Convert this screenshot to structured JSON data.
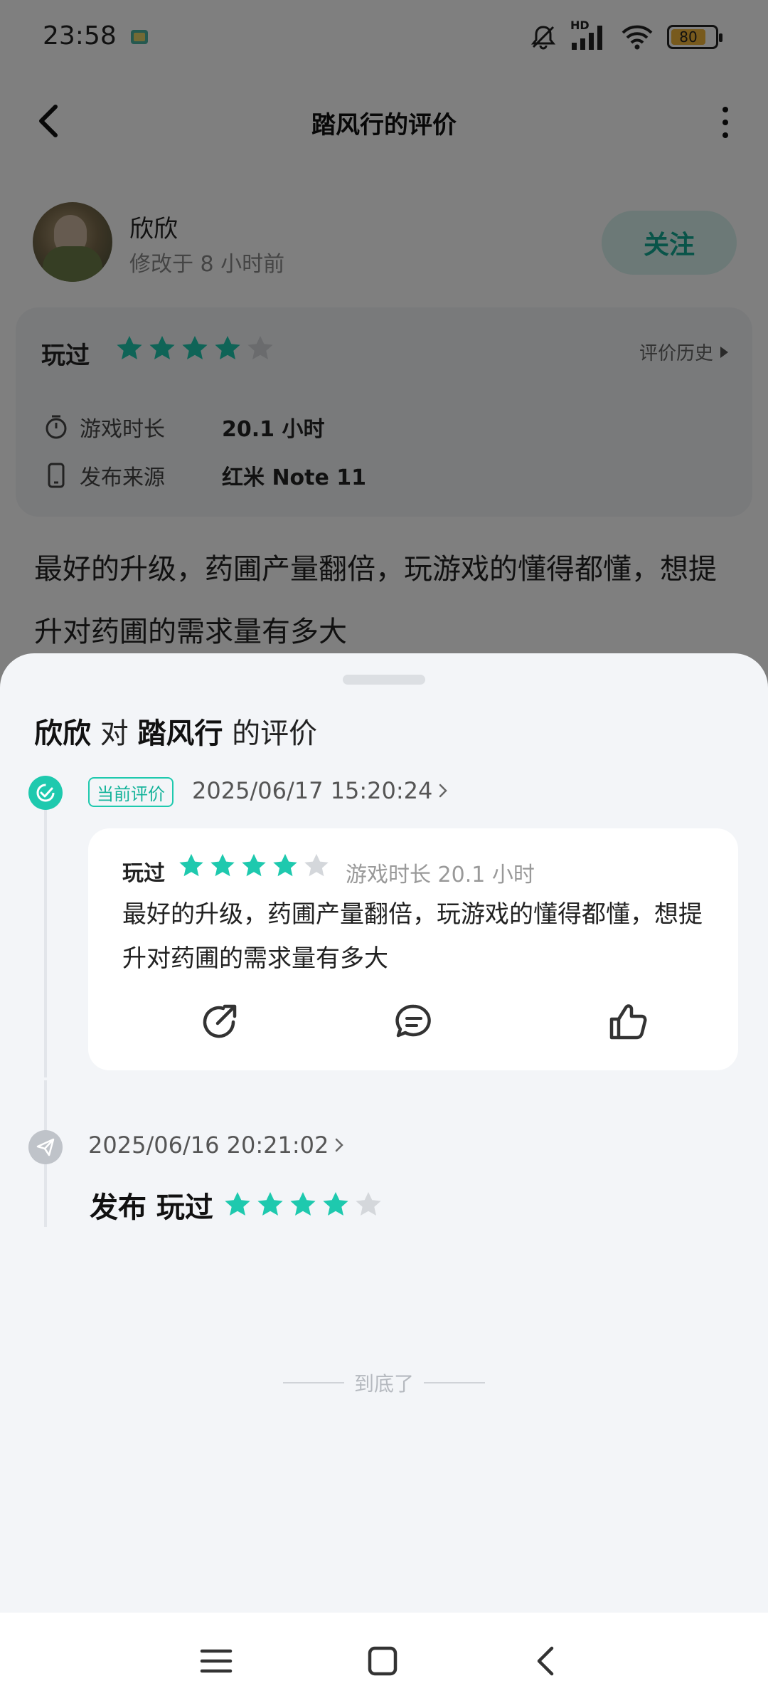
{
  "status_bar": {
    "time": "23:58",
    "network_label": "HD",
    "battery": "80",
    "icons": [
      "bell-muted-icon",
      "signal-icon",
      "wifi-icon",
      "battery-icon"
    ]
  },
  "header": {
    "title": "踏风行的评价"
  },
  "author": {
    "name": "欣欣",
    "meta": "修改于 8 小时前",
    "follow_label": "关注"
  },
  "info_card": {
    "played_label": "玩过",
    "rating": 4,
    "rating_max": 5,
    "history_label": "评价历史",
    "rows": [
      {
        "label": "游戏时长",
        "value": "20.1 小时",
        "icon": "timer-icon"
      },
      {
        "label": "发布来源",
        "value": "红米 Note 11",
        "icon": "phone-icon"
      }
    ]
  },
  "review_text": "最好的升级，药圃产量翻倍，玩游戏的懂得都懂，想提升对药圃的需求量有多大",
  "sheet": {
    "title_user": "欣欣",
    "title_mid": "对",
    "title_game": "踏风行",
    "title_end": "的评价",
    "entries": [
      {
        "badge": "当前评价",
        "timestamp": "2025/06/17 15:20:24",
        "played_label": "玩过",
        "rating": 4,
        "duration": "游戏时长 20.1 小时",
        "text": "最好的升级，药圃产量翻倍，玩游戏的懂得都懂，想提升对药圃的需求量有多大",
        "actions": [
          "share-icon",
          "comment-icon",
          "like-icon"
        ]
      },
      {
        "timestamp": "2025/06/16 20:21:02",
        "action_text": "发布 玩过",
        "rating": 4
      }
    ],
    "end_text": "到底了"
  },
  "colors": {
    "accent": "#1ec9ae",
    "star_on": "#1ec9ae",
    "star_off": "#d4d7db",
    "follow_text": "#12a993",
    "sheet_bg": "#f3f5f8"
  }
}
